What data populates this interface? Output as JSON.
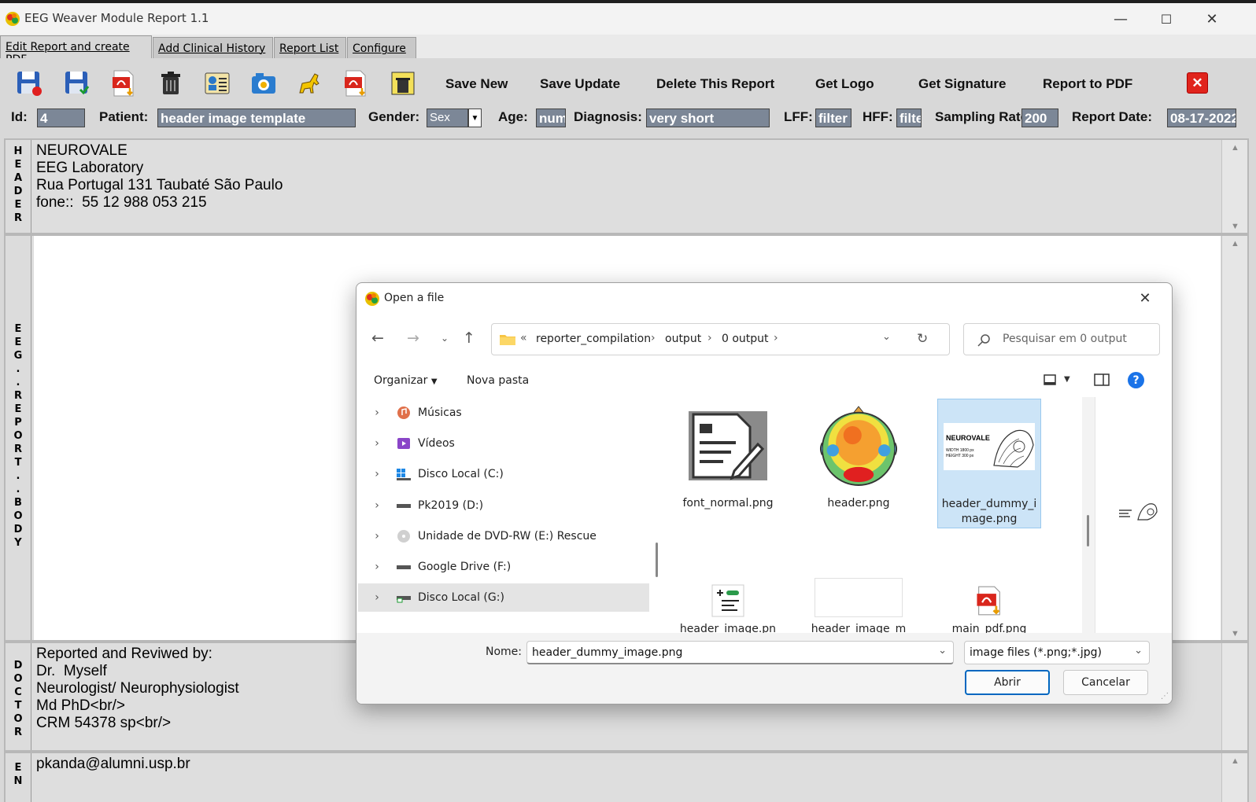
{
  "window": {
    "title": "EEG Weaver Module Report 1.1",
    "minimize": "—",
    "maximize": "☐",
    "close": "✕"
  },
  "tabs": [
    {
      "label": "Edit Report and create PDF"
    },
    {
      "label": "Add Clinical History"
    },
    {
      "label": "Report List"
    },
    {
      "label": "Configure"
    }
  ],
  "toolbar": {
    "save_new": "Save New",
    "save_update": "Save Update",
    "delete_report": "Delete This Report",
    "get_logo": "Get Logo",
    "get_signature": "Get Signature",
    "report_to_pdf": "Report to PDF",
    "close_icon": "✕"
  },
  "fields": {
    "id_label": "Id:",
    "id_value": "4",
    "patient_label": "Patient:",
    "patient_value": "header image template",
    "gender_label": "Gender:",
    "gender_value": "Sex",
    "age_label": "Age:",
    "age_value": "num",
    "diagnosis_label": "Diagnosis:",
    "diagnosis_value": "very short",
    "lff_label": "LFF:",
    "lff_value": "filter",
    "hff_label": "HFF:",
    "hff_value": "filte",
    "sampling_label": "Sampling Rate",
    "sampling_value": "200",
    "date_label": "Report Date:",
    "date_value": "08-17-2022"
  },
  "header_panel": {
    "side": [
      "H",
      "E",
      "A",
      "D",
      "E",
      "R"
    ],
    "lines": [
      "NEUROVALE",
      "EEG Laboratory",
      "Rua Portugal 131 Taubaté São Paulo",
      "fone::  55 12 988 053 215"
    ]
  },
  "body_panel": {
    "side": [
      "E",
      "E",
      "G",
      ".",
      ".",
      "R",
      "E",
      "P",
      "O",
      "R",
      "T",
      ".",
      ".",
      "B",
      "O",
      "D",
      "Y"
    ]
  },
  "doctor_panel": {
    "side": [
      "D",
      "O",
      "C",
      "T",
      "O",
      "R"
    ],
    "lines": [
      "Reported and Reviwed by:",
      "Dr.  Myself",
      "Neurologist/ Neurophysiologist",
      "Md PhD<br/>",
      "CRM 54378 sp<br/>"
    ]
  },
  "end_panel": {
    "side": [
      "E",
      "N"
    ],
    "lines": [
      "pkanda@alumni.usp.br"
    ]
  },
  "dialog": {
    "title": "Open a file",
    "breadcrumb_prefix": "«",
    "breadcrumb": [
      "reporter_compilation",
      "output",
      "0 output"
    ],
    "search_placeholder": "Pesquisar em 0 output",
    "organize": "Organizar",
    "new_folder": "Nova pasta",
    "nav_items": [
      {
        "label": "Músicas",
        "icon": "music-icon"
      },
      {
        "label": "Vídeos",
        "icon": "video-icon"
      },
      {
        "label": "Disco Local (C:)",
        "icon": "windows-drive-icon"
      },
      {
        "label": "Pk2019 (D:)",
        "icon": "drive-icon"
      },
      {
        "label": "Unidade de DVD-RW (E:) Rescue",
        "icon": "dvd-icon"
      },
      {
        "label": "Google Drive (F:)",
        "icon": "drive-icon"
      },
      {
        "label": "Disco Local (G:)",
        "icon": "drive-icon"
      }
    ],
    "files": [
      {
        "name": "font_normal.png"
      },
      {
        "name": "header.png"
      },
      {
        "name": "header_dummy_image.png"
      },
      {
        "name": "header_image.pn"
      },
      {
        "name": "header_image_m"
      },
      {
        "name": "main_pdf.png"
      }
    ],
    "thumb_text": [
      "NEUROVALE",
      "WIDTH 1800 px",
      "HEIGHT 300 px"
    ],
    "filename_label": "Nome:",
    "filename_value": "header_dummy_image.png",
    "filetype_value": "image files (*.png;*.jpg)",
    "open_button": "Abrir",
    "cancel_button": "Cancelar"
  }
}
